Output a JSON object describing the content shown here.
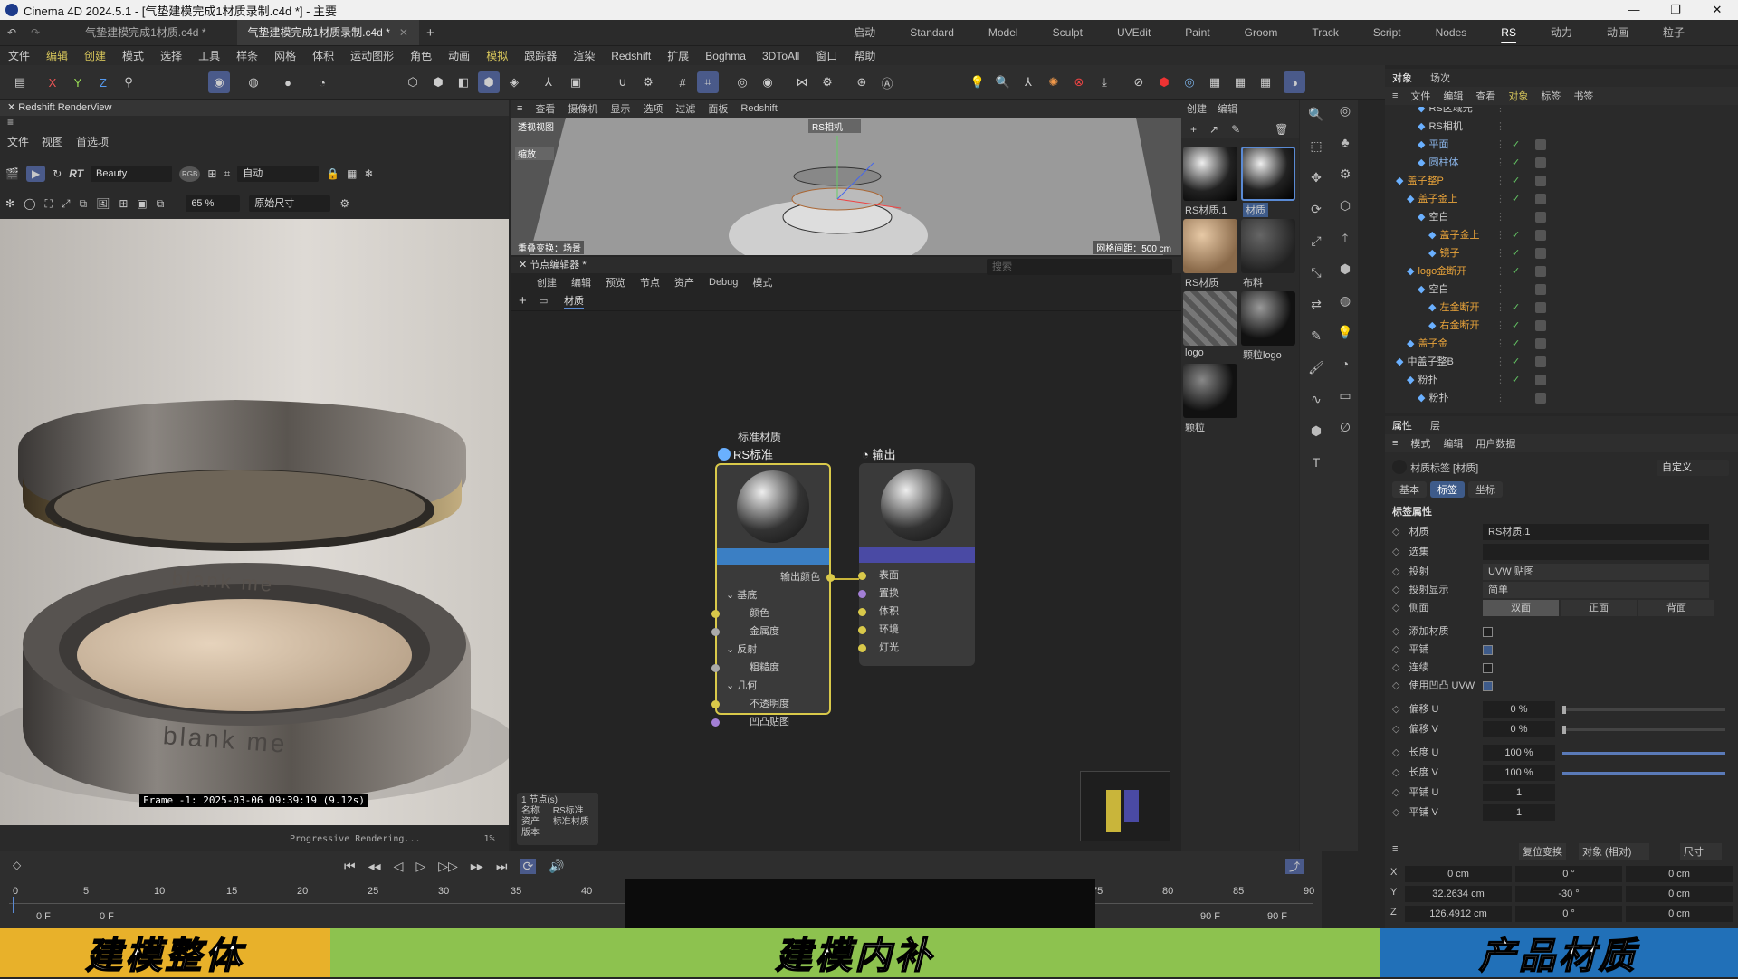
{
  "titlebar": {
    "title": "Cinema 4D 2024.5.1 - [气垫建模完成1材质录制.c4d *] - 主要"
  },
  "tabs": [
    {
      "label": "气垫建模完成1材质.c4d *"
    },
    {
      "label": "气垫建模完成1材质录制.c4d *"
    }
  ],
  "layouts": [
    "启动",
    "Standard",
    "Model",
    "Sculpt",
    "UVEdit",
    "Paint",
    "Groom",
    "Track",
    "Script",
    "Nodes",
    "RS",
    "动力",
    "动画",
    "粒子"
  ],
  "menu": [
    "文件",
    "编辑",
    "创建",
    "模式",
    "选择",
    "工具",
    "样条",
    "网格",
    "体积",
    "运动图形",
    "角色",
    "动画",
    "模拟",
    "跟踪器",
    "渲染",
    "Redshift",
    "扩展",
    "Boghma",
    "3DToAll",
    "窗口",
    "帮助"
  ],
  "renderview": {
    "title": "Redshift RenderView",
    "menu": [
      "文件",
      "视图",
      "首选项"
    ],
    "aov": "Beauty",
    "bucket": "自动",
    "zoom": "65 %",
    "size": "原始尺寸",
    "frame_info": "Frame  -1:  2025-03-06  09:39:19  (9.12s)",
    "progress_text": "Progressive Rendering...",
    "progress_pct": "1%",
    "brand_lid": "blank me",
    "brand_base": "blank me"
  },
  "viewport": {
    "menu": [
      "查看",
      "摄像机",
      "显示",
      "选项",
      "过滤",
      "面板",
      "Redshift"
    ],
    "name": "透视视图",
    "camera": "RS相机",
    "zoom_label": "缩放",
    "bottom_left": "重叠变换：场景",
    "bottom_right": "网格间距：500 cm"
  },
  "node_editor": {
    "title": "节点编辑器 *",
    "menu": [
      "创建",
      "编辑",
      "预览",
      "节点",
      "资产",
      "Debug",
      "模式"
    ],
    "crumb": "材质",
    "search_placeholder": "搜索",
    "std_title": "标准材质",
    "std_name": "RS标准",
    "std_out": "输出颜色",
    "std_groups": {
      "base": "基底",
      "reflect": "反射",
      "geo": "几何"
    },
    "std_ports": {
      "color": "颜色",
      "metal": "金属度",
      "rough": "粗糙度",
      "opacity": "不透明度",
      "bump": "凹凸贴图"
    },
    "out_name": "输出",
    "out_ports": [
      "表面",
      "置换",
      "体积",
      "环境",
      "灯光"
    ],
    "info": {
      "count": "1 节点(s)",
      "name_k": "名称",
      "name_v": "RS标准",
      "asset_k": "资产",
      "asset_v": "标准材质",
      "ver_k": "版本",
      "ver_v": ""
    }
  },
  "materials": {
    "menu": [
      "创建",
      "编辑"
    ],
    "items": [
      "RS材质.1",
      "材质",
      "RS材质",
      "布料",
      "logo",
      "颗粒logo",
      "颗粒"
    ]
  },
  "objects": {
    "tabs": [
      "对象",
      "场次"
    ],
    "menu": [
      "文件",
      "编辑",
      "查看",
      "对象",
      "标签",
      "书签"
    ],
    "rows": [
      "RS区域光",
      "RS相机",
      "平面",
      "圆柱体",
      "盖子整P",
      "盖子金上",
      "空白",
      "盖子金上",
      "镜子",
      "logo金断开",
      "空白",
      "左金断开",
      "右金断开",
      "盖子金",
      "中盖子整B",
      "粉扑",
      "粉扑"
    ]
  },
  "attributes": {
    "tabs": [
      "属性",
      "层"
    ],
    "menu": [
      "模式",
      "编辑",
      "用户数据"
    ],
    "mode": "自定义",
    "header": "材质标签 [材质]",
    "subtabs": [
      "基本",
      "标签",
      "坐标"
    ],
    "section": "标签属性",
    "material_label": "材质",
    "material_value": "RS材质.1",
    "selection_label": "选集",
    "projection_label": "投射",
    "projection_value": "UVW 贴图",
    "projdisplay_label": "投射显示",
    "projdisplay_value": "简单",
    "side_label": "侧面",
    "side_options": [
      "双面",
      "正面",
      "背面"
    ],
    "checks": [
      {
        "label": "添加材质",
        "checked": false
      },
      {
        "label": "平铺",
        "checked": true
      },
      {
        "label": "连续",
        "checked": false
      },
      {
        "label": "使用凹凸 UVW",
        "checked": true
      }
    ],
    "offset_u_label": "偏移 U",
    "offset_u": "0 %",
    "offset_u_frac": 0,
    "offset_v_label": "偏移 V",
    "offset_v": "0 %",
    "offset_v_frac": 0,
    "length_u_label": "长度 U",
    "length_u": "100 %",
    "length_u_frac": 1,
    "length_v_label": "长度 V",
    "length_v": "100 %",
    "length_v_frac": 1,
    "tile_u_label": "平铺 U",
    "tile_u": "1",
    "tile_v_label": "平铺 V",
    "tile_v": "1"
  },
  "coords": {
    "reset": "复位变换",
    "mode": "对象 (相对)",
    "size": "尺寸",
    "rows": [
      {
        "axis": "X",
        "pos": "0 cm",
        "rot": "0 °",
        "size": "0 cm"
      },
      {
        "axis": "Y",
        "pos": "32.2634 cm",
        "rot": "-30 °",
        "size": "0 cm"
      },
      {
        "axis": "Z",
        "pos": "126.4912 cm",
        "rot": "0 °",
        "size": "0 cm"
      }
    ]
  },
  "timeline": {
    "ticks": [
      "0",
      "5",
      "10",
      "15",
      "20",
      "25",
      "30",
      "35",
      "40",
      "75",
      "80",
      "85",
      "90"
    ],
    "start": "0 F",
    "current": "0 F",
    "end": "90 F",
    "end2": "90 F"
  },
  "banner": [
    {
      "text": "建模整体",
      "color": "#e8b12a"
    },
    {
      "text": "建模内补",
      "color": "#8dc24f"
    },
    {
      "text": "产品材质",
      "color": "#2170b8"
    }
  ]
}
